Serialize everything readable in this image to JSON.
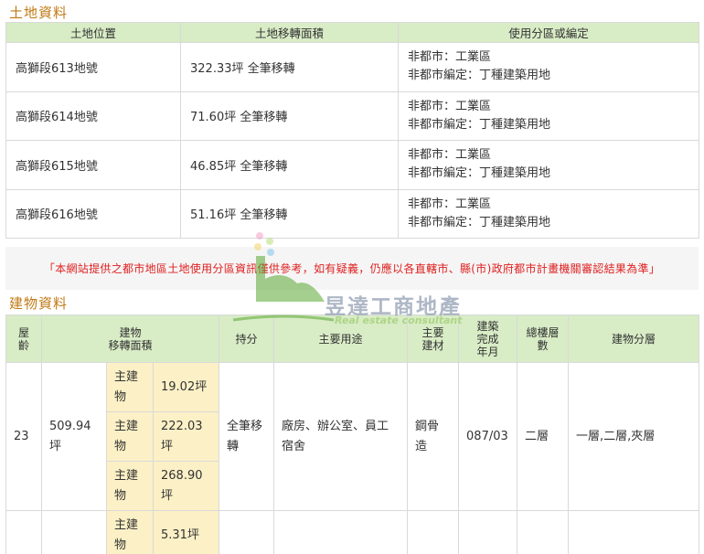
{
  "land": {
    "title": "土地資料",
    "headers": [
      "土地位置",
      "土地移轉面積",
      "使用分區或編定"
    ],
    "rows": [
      {
        "location": "高獅段613地號",
        "area": "322.33坪 全筆移轉",
        "zone1": "非都市：工業區",
        "zone2": "非都市編定：丁種建築用地"
      },
      {
        "location": "高獅段614地號",
        "area": "71.60坪 全筆移轉",
        "zone1": "非都市：工業區",
        "zone2": "非都市編定：丁種建築用地"
      },
      {
        "location": "高獅段615地號",
        "area": "46.85坪 全筆移轉",
        "zone1": "非都市：工業區",
        "zone2": "非都市編定：丁種建築用地"
      },
      {
        "location": "高獅段616地號",
        "area": "51.16坪 全筆移轉",
        "zone1": "非都市：工業區",
        "zone2": "非都市編定：丁種建築用地"
      }
    ]
  },
  "notice": "「本網站提供之都市地區土地使用分區資訊僅供參考，如有疑義，仍應以各直轄市、縣(市)政府都市計畫機關審認結果為準」",
  "building": {
    "title": "建物資料",
    "headers": {
      "age": "屋齡",
      "area_l1": "建物",
      "area_l2": "移轉面積",
      "share": "持分",
      "use": "主要用途",
      "material": "主要建材",
      "completed": "建築完成年月",
      "floors": "總樓層數",
      "layer": "建物分層"
    },
    "row": {
      "age": "23",
      "area": "509.94坪",
      "sub": [
        {
          "label": "主建物",
          "value": "19.02坪"
        },
        {
          "label": "主建物",
          "value": "222.03坪"
        },
        {
          "label": "主建物",
          "value": "268.90坪"
        }
      ],
      "share": "全筆移轉",
      "use": "廠房、辦公室、員工宿舍",
      "material": "鋼骨造",
      "completed": "087/03",
      "floors": "二層",
      "layer": "一層,二層,夾層"
    },
    "row2": {
      "sub": [
        {
          "label": "主建物",
          "value": "5.31坪"
        }
      ]
    }
  },
  "watermark": {
    "name": "昱達工商地產",
    "sub": "Real estate consultant"
  }
}
